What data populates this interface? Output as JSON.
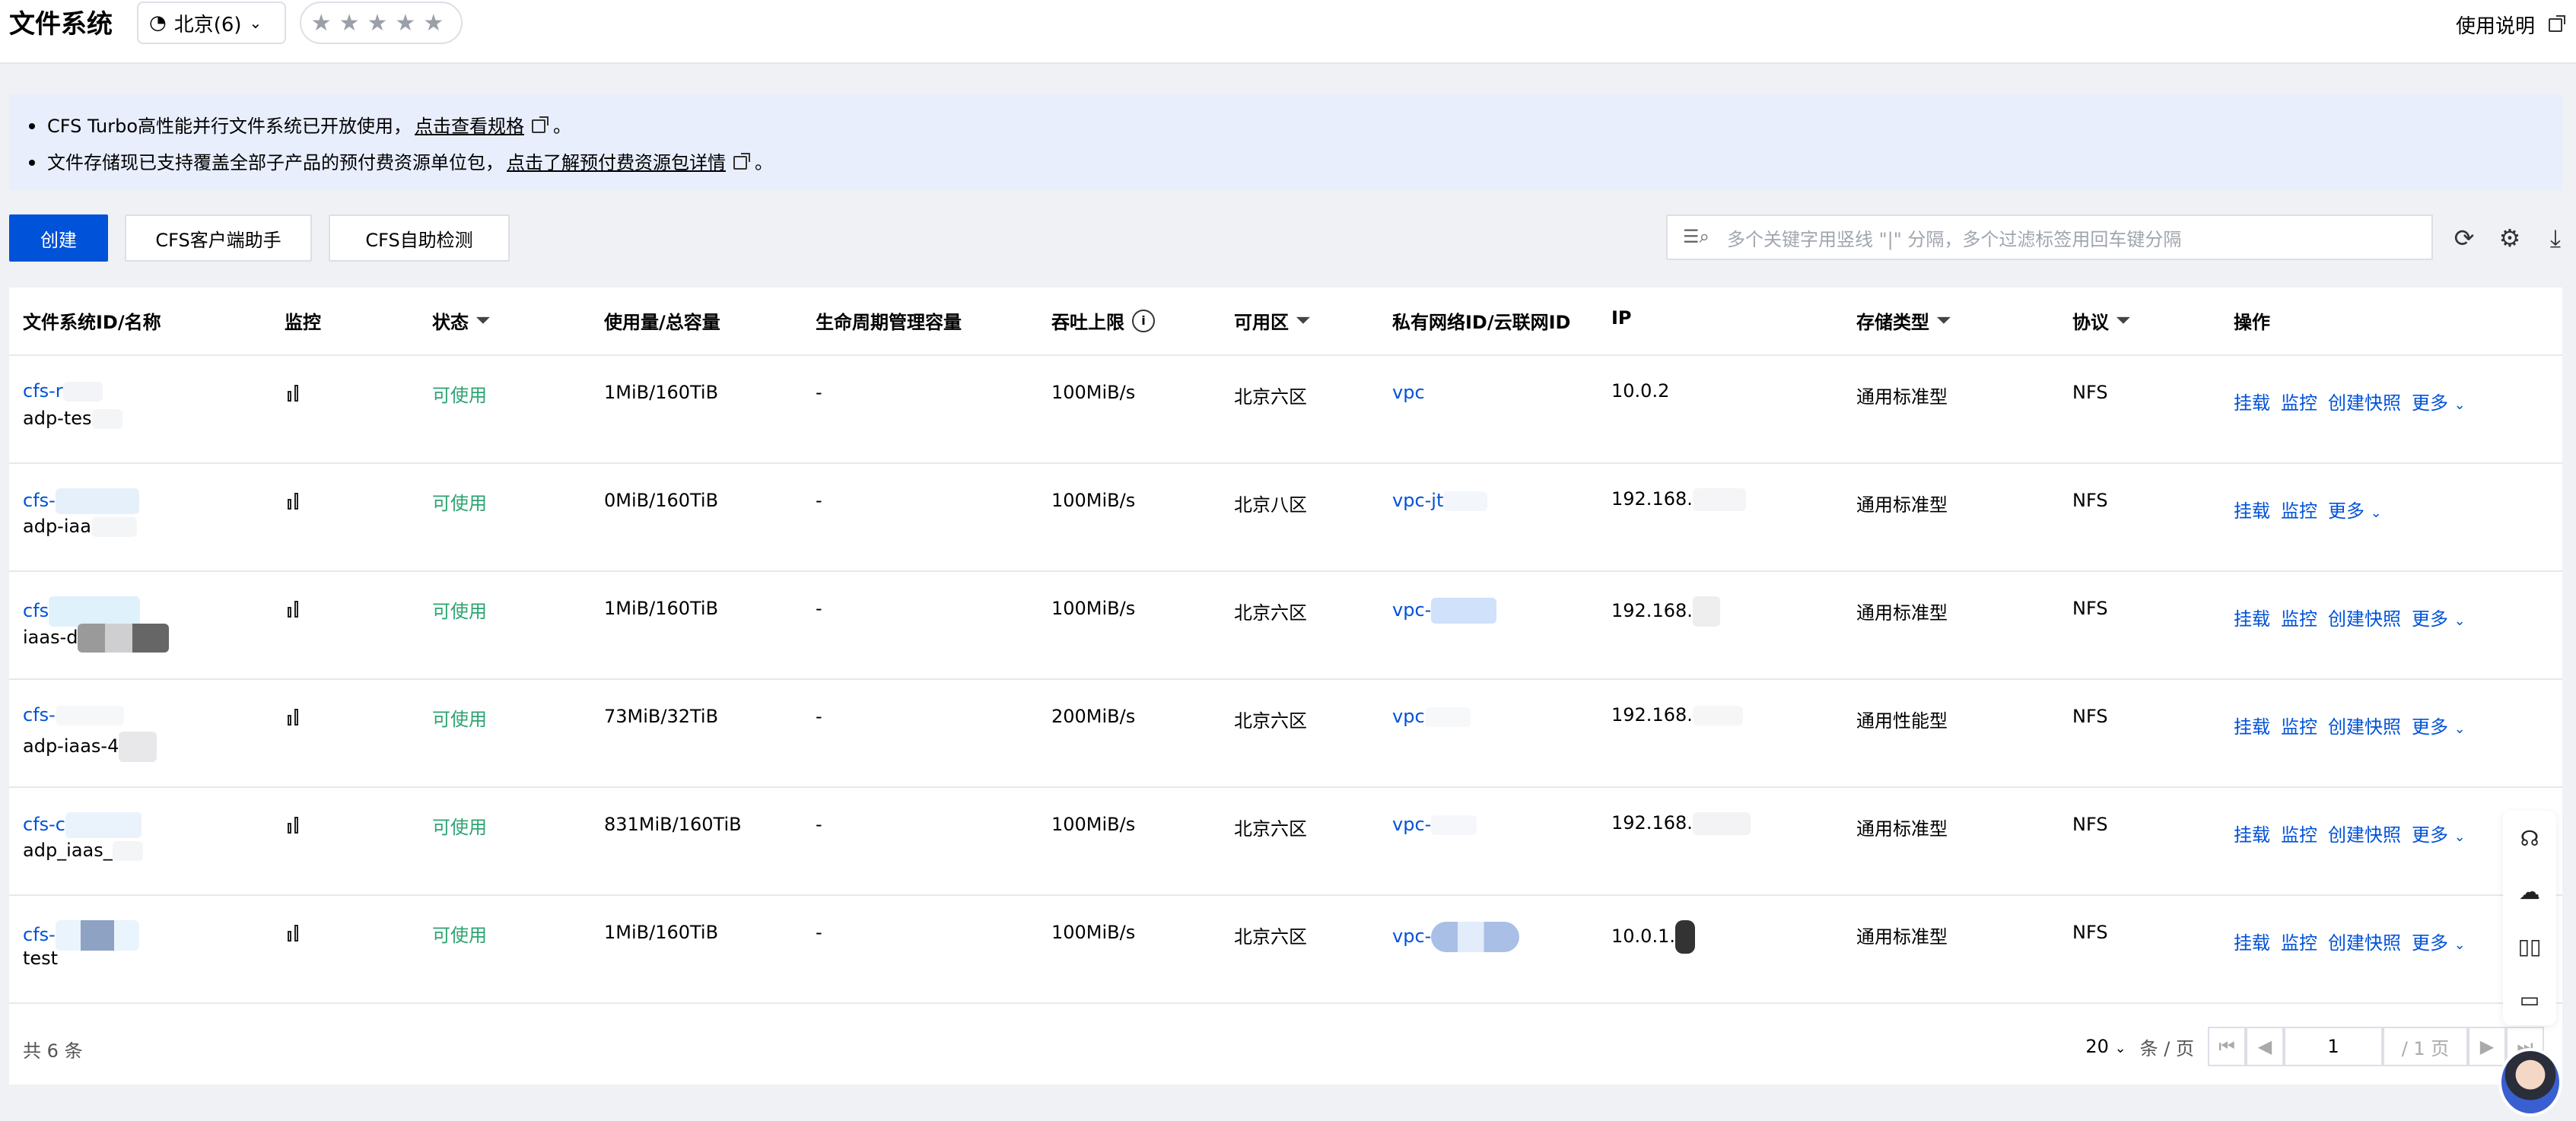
{
  "header": {
    "title": "文件系统",
    "region": "北京(6)",
    "rating_stars": "★★★★★",
    "help": "使用说明"
  },
  "notice": {
    "line1_text": "CFS Turbo高性能并行文件系统已开放使用，",
    "line1_link": "点击查看规格",
    "line2_text": "文件存储现已支持覆盖全部子产品的预付费资源单位包，",
    "line2_link": "点击了解预付费资源包详情",
    "end_mark": "。"
  },
  "toolbar": {
    "create": "创建",
    "client_helper": "CFS客户端助手",
    "self_check": "CFS自助检测",
    "search_placeholder": "多个关键字用竖线 \"|\" 分隔，多个过滤标签用回车键分隔"
  },
  "table": {
    "columns": {
      "id_name": "文件系统ID/名称",
      "monitor": "监控",
      "status": "状态",
      "usage": "使用量/总容量",
      "lifecycle": "生命周期管理容量",
      "throughput": "吞吐上限",
      "zone": "可用区",
      "vpc": "私有网络ID/云联网ID",
      "ip": "IP",
      "storage_type": "存储类型",
      "protocol": "协议",
      "actions": "操作"
    },
    "rows": [
      {
        "id": "cfs-r",
        "name": "adp-tes",
        "status": "可使用",
        "usage": "1MiB/160TiB",
        "lifecycle": "-",
        "throughput": "100MiB/s",
        "zone": "北京六区",
        "vpc": "vpc",
        "ip": "10.0.2",
        "storage": "通用标准型",
        "protocol": "NFS",
        "ops": [
          "挂载",
          "监控",
          "创建快照",
          "更多"
        ]
      },
      {
        "id": "cfs-",
        "name": "adp-iaa",
        "status": "可使用",
        "usage": "0MiB/160TiB",
        "lifecycle": "-",
        "throughput": "100MiB/s",
        "zone": "北京八区",
        "vpc": "vpc-jt",
        "ip": "192.168.",
        "storage": "通用标准型",
        "protocol": "NFS",
        "ops": [
          "挂载",
          "监控",
          "更多"
        ]
      },
      {
        "id": "cfs",
        "name": "iaas-d",
        "status": "可使用",
        "usage": "1MiB/160TiB",
        "lifecycle": "-",
        "throughput": "100MiB/s",
        "zone": "北京六区",
        "vpc": "vpc-",
        "ip": "192.168.",
        "storage": "通用标准型",
        "protocol": "NFS",
        "ops": [
          "挂载",
          "监控",
          "创建快照",
          "更多"
        ]
      },
      {
        "id": "cfs-",
        "name": "adp-iaas-4",
        "status": "可使用",
        "usage": "73MiB/32TiB",
        "lifecycle": "-",
        "throughput": "200MiB/s",
        "zone": "北京六区",
        "vpc": "vpc",
        "ip": "192.168.",
        "storage": "通用性能型",
        "protocol": "NFS",
        "ops": [
          "挂载",
          "监控",
          "创建快照",
          "更多"
        ]
      },
      {
        "id": "cfs-c",
        "name": "adp_iaas_",
        "status": "可使用",
        "usage": "831MiB/160TiB",
        "lifecycle": "-",
        "throughput": "100MiB/s",
        "zone": "北京六区",
        "vpc": "vpc-",
        "ip": "192.168.",
        "storage": "通用标准型",
        "protocol": "NFS",
        "ops": [
          "挂载",
          "监控",
          "创建快照",
          "更多"
        ]
      },
      {
        "id": "cfs-",
        "name": "test",
        "status": "可使用",
        "usage": "1MiB/160TiB",
        "lifecycle": "-",
        "throughput": "100MiB/s",
        "zone": "北京六区",
        "vpc": "vpc-",
        "ip": "10.0.1.",
        "storage": "通用标准型",
        "protocol": "NFS",
        "ops": [
          "挂载",
          "监控",
          "创建快照",
          "更多"
        ]
      }
    ]
  },
  "footer": {
    "total": "共 6 条",
    "page_size": "20",
    "per_page": "条 / 页",
    "current_page": "1",
    "total_pages": "/ 1 页"
  },
  "colors": {
    "primary": "#0052d9",
    "success": "#2ba471",
    "notice_bg": "#e8eefc"
  },
  "icons": [
    "region-icon",
    "chevron-down-icon",
    "star-icon",
    "external-link-icon",
    "search-filter-icon",
    "refresh-icon",
    "settings-icon",
    "download-icon",
    "monitor-chart-icon",
    "filter-icon",
    "info-icon",
    "first-page-icon",
    "prev-page-icon",
    "next-page-icon",
    "last-page-icon",
    "headset-icon",
    "cloud-icon",
    "book-icon",
    "feedback-icon",
    "assistant-avatar"
  ]
}
